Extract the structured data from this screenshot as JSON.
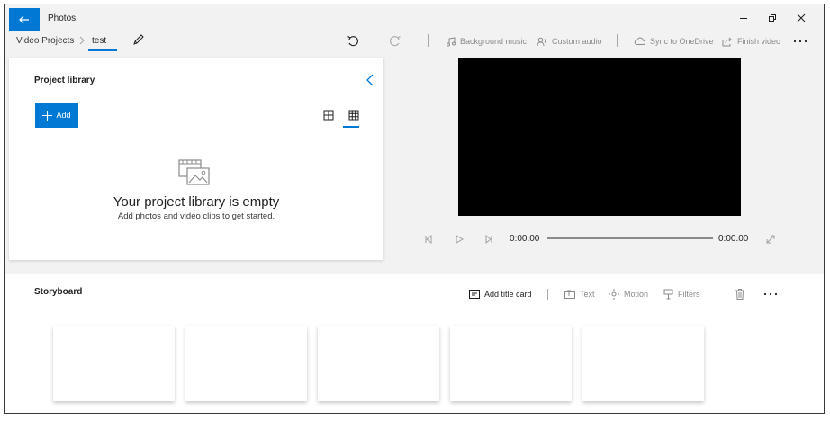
{
  "app": {
    "title": "Photos"
  },
  "breadcrumb": {
    "parent": "Video Projects",
    "current": "test"
  },
  "toolbar": {
    "background_music": "Background music",
    "custom_audio": "Custom audio",
    "sync": "Sync to OneDrive",
    "finish": "Finish video"
  },
  "library": {
    "title": "Project library",
    "add_label": "Add",
    "empty_title": "Your project library is empty",
    "empty_subtitle": "Add photos and video clips to get started."
  },
  "player": {
    "current_time": "0:00.00",
    "total_time": "0:00.00"
  },
  "storyboard": {
    "title": "Storyboard",
    "add_title_card": "Add title card",
    "text": "Text",
    "motion": "Motion",
    "filters": "Filters"
  },
  "colors": {
    "accent": "#0078d4",
    "video_bg": "#000000",
    "panel_bg": "#f2f2f2"
  },
  "icons": [
    "back-arrow-icon",
    "minimize-icon",
    "restore-icon",
    "close-icon",
    "chevron-right-icon",
    "pencil-icon",
    "undo-icon",
    "redo-icon",
    "music-note-icon",
    "person-audio-icon",
    "cloud-icon",
    "share-icon",
    "more-icon",
    "chevron-left-icon",
    "plus-icon",
    "grid-small-icon",
    "grid-large-icon",
    "empty-library-icon",
    "previous-frame-icon",
    "play-icon",
    "next-frame-icon",
    "expand-icon",
    "title-card-icon",
    "text-icon",
    "motion-icon",
    "filters-icon",
    "trash-icon"
  ]
}
